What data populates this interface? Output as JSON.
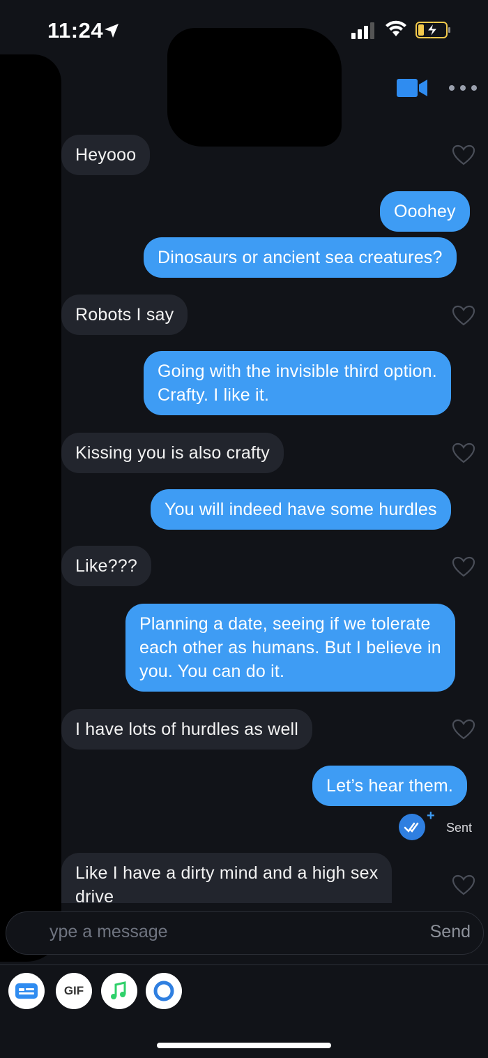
{
  "status_bar": {
    "time": "11:24"
  },
  "header": {
    "video_icon": "video-camera-icon",
    "more_icon": "more-dots-icon"
  },
  "messages": [
    {
      "side": "received",
      "text": "Heyooo"
    },
    {
      "side": "sent",
      "text": "Ooohey"
    },
    {
      "side": "sent",
      "text": "Dinosaurs or ancient sea creatures?"
    },
    {
      "side": "received",
      "text": "Robots I say"
    },
    {
      "side": "sent",
      "text": "Going with the invisible third option.\nCrafty. I like it."
    },
    {
      "side": "received",
      "text": "Kissing you is also crafty"
    },
    {
      "side": "sent",
      "text": "You will indeed have some hurdles"
    },
    {
      "side": "received",
      "text": "Like???"
    },
    {
      "side": "sent",
      "text": "Planning a date, seeing if we tolerate\neach other as humans. But I believe in\nyou. You can do it."
    },
    {
      "side": "received",
      "text": "I have lots of hurdles as well"
    },
    {
      "side": "sent",
      "text": "Let’s hear them."
    },
    {
      "side": "received",
      "text": "Like I have a dirty mind and a high sex\ndrive"
    }
  ],
  "sent_status": {
    "label": "Sent",
    "plus": "+"
  },
  "composer": {
    "placeholder": "ype a message",
    "send_label": "Send"
  },
  "tools": {
    "gif_label": "GIF",
    "icons": [
      "card-icon",
      "gif-icon",
      "music-icon",
      "circle-icon"
    ]
  },
  "colors": {
    "background": "#111318",
    "sent_bubble": "#3e9cf4",
    "received_bubble": "#22252d",
    "accent": "#2f7fe0"
  }
}
